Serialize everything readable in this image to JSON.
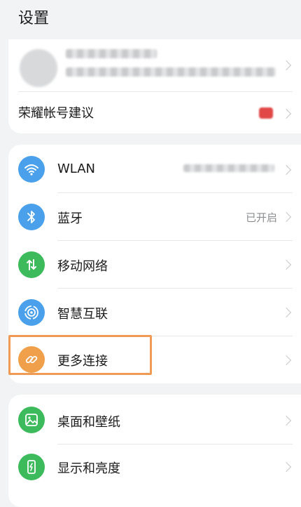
{
  "header": {
    "title": "设置"
  },
  "account": {
    "name": "",
    "subtitle": "",
    "suggestion_label": "荣耀帐号建议"
  },
  "connectivity": {
    "items": [
      {
        "label": "WLAN",
        "value": "",
        "icon": "wifi-icon",
        "color": "#4aa0ea"
      },
      {
        "label": "蓝牙",
        "value": "已开启",
        "icon": "bluetooth-icon",
        "color": "#4aa0ea"
      },
      {
        "label": "移动网络",
        "value": "",
        "icon": "mobile-data-icon",
        "color": "#3dba5b"
      },
      {
        "label": "智慧互联",
        "value": "",
        "icon": "smart-connect-icon",
        "color": "#4aa0ea"
      },
      {
        "label": "更多连接",
        "value": "",
        "icon": "link-icon",
        "color": "#f0a04b"
      }
    ]
  },
  "display": {
    "items": [
      {
        "label": "桌面和壁纸",
        "icon": "wallpaper-icon",
        "color": "#3dba5b"
      },
      {
        "label": "显示和亮度",
        "icon": "brightness-icon",
        "color": "#3dba5b"
      }
    ]
  },
  "highlight": {
    "target": "更多连接",
    "color": "#ef9b55"
  }
}
